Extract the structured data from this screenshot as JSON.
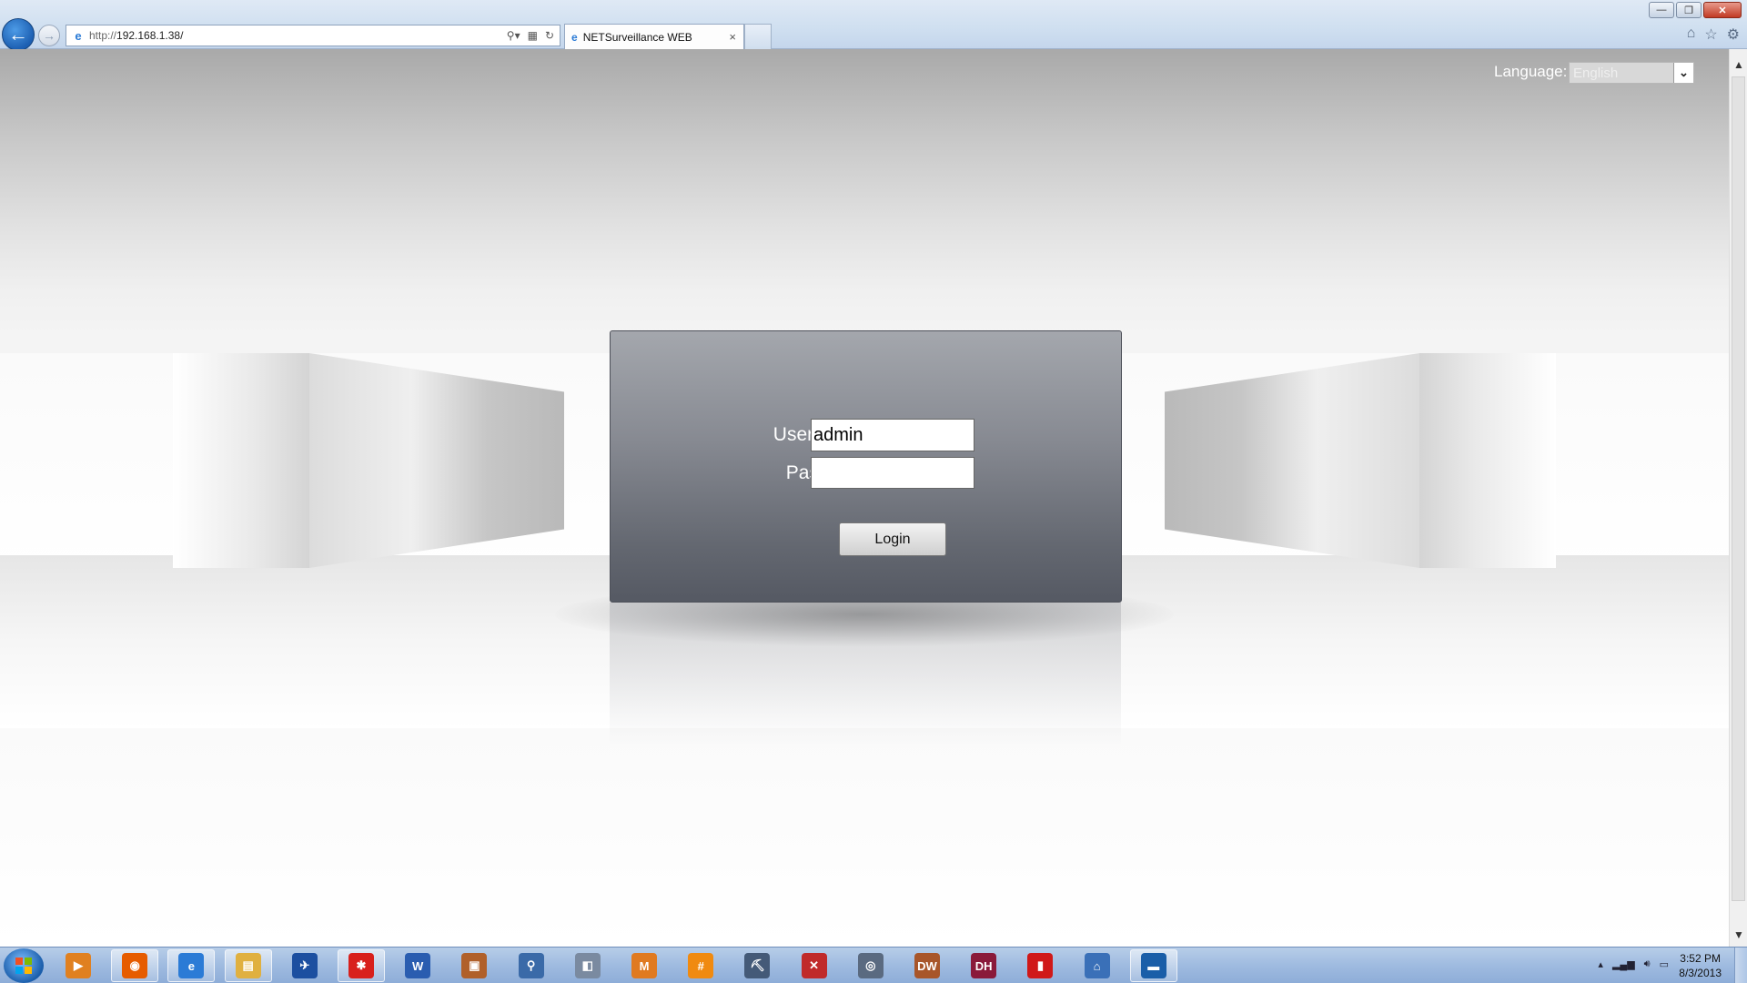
{
  "browser": {
    "address": {
      "url_prefix": "http://",
      "url_host": "192.168.1.38/"
    },
    "tab": {
      "title": "NETSurveillance WEB",
      "close": "×"
    },
    "icons": [
      "back-arrow-icon",
      "forward-arrow-icon",
      "ie-page-icon",
      "search-icon",
      "compatibility-icon",
      "refresh-icon",
      "home-icon",
      "favorites-star-icon",
      "tools-gear-icon"
    ],
    "window_controls": {
      "minimize": "—",
      "restore": "❐",
      "close": "✕"
    }
  },
  "page": {
    "language": {
      "label": "Language:",
      "selected": "English"
    },
    "login": {
      "username_label": "User Name",
      "username_value": "admin",
      "password_label": "Password",
      "password_value": "",
      "button": "Login"
    }
  },
  "taskbar": {
    "apps": [
      {
        "name": "media-player-icon",
        "glyph": "▶",
        "color": "#e08020"
      },
      {
        "name": "firefox-icon",
        "glyph": "◉",
        "color": "#e65c00"
      },
      {
        "name": "internet-explorer-icon",
        "glyph": "e",
        "color": "#2b7bd6"
      },
      {
        "name": "file-explorer-icon",
        "glyph": "▤",
        "color": "#e0b040"
      },
      {
        "name": "app-bird-icon",
        "glyph": "✈",
        "color": "#1c4fa0"
      },
      {
        "name": "app-red-splat-icon",
        "glyph": "✱",
        "color": "#d8201c"
      },
      {
        "name": "word-icon",
        "glyph": "W",
        "color": "#2a5db0"
      },
      {
        "name": "app-package-icon",
        "glyph": "▣",
        "color": "#b0602a"
      },
      {
        "name": "app-magnifier-icon",
        "glyph": "⚲",
        "color": "#3a6aa8"
      },
      {
        "name": "secure-cam-icon",
        "glyph": "◧",
        "color": "#7a8aa0"
      },
      {
        "name": "app-abc-icon",
        "glyph": "M",
        "color": "#e07a20"
      },
      {
        "name": "hash-app-icon",
        "glyph": "#",
        "color": "#f08a10"
      },
      {
        "name": "pickaxe-icon",
        "glyph": "⛏",
        "color": "#445a78"
      },
      {
        "name": "x-app-icon",
        "glyph": "✕",
        "color": "#c02a2a"
      },
      {
        "name": "disk-app-icon",
        "glyph": "◎",
        "color": "#5a6a80"
      },
      {
        "name": "dw-app-icon",
        "glyph": "DW",
        "color": "#a8562a"
      },
      {
        "name": "cms-dh-icon",
        "glyph": "DH",
        "color": "#8a1a3a"
      },
      {
        "name": "color-bars-icon",
        "glyph": "▮",
        "color": "#d01818"
      },
      {
        "name": "network-house-icon",
        "glyph": "⌂",
        "color": "#3a70b8"
      },
      {
        "name": "monitor-app-icon",
        "glyph": "▬",
        "color": "#1a5ea8"
      }
    ],
    "tray_icons": [
      "show-hidden-icons-icon",
      "network-signal-icon",
      "volume-icon",
      "power-icon"
    ],
    "clock": {
      "time": "3:52 PM",
      "date": "8/3/2013"
    }
  }
}
